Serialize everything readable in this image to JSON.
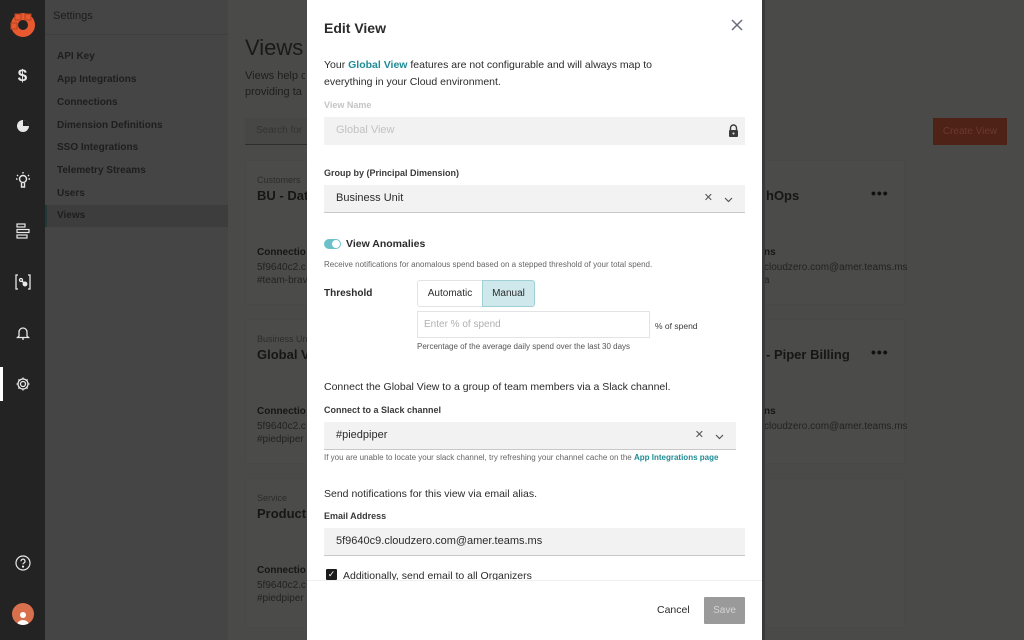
{
  "rail": {
    "icons": [
      "cloudzero-logo-icon",
      "dollar-icon",
      "pie-chart-icon",
      "lightbulb-icon",
      "list-icon",
      "bracket-node-icon",
      "bell-icon",
      "gear-icon",
      "help-icon",
      "user-avatar-icon"
    ],
    "active": "gear-icon",
    "brand_color": "#e8592f"
  },
  "settings": {
    "title": "Settings",
    "items": [
      {
        "label": "API Key"
      },
      {
        "label": "App Integrations"
      },
      {
        "label": "Connections"
      },
      {
        "label": "Dimension Definitions"
      },
      {
        "label": "SSO Integrations"
      },
      {
        "label": "Telemetry Streams"
      },
      {
        "label": "Users"
      },
      {
        "label": "Views",
        "active": true
      }
    ]
  },
  "page": {
    "title": "Views",
    "desc_line1": "Views help c",
    "desc_line2": "providing ta",
    "search_placeholder": "Search for",
    "create_button": "Create View",
    "cards": [
      {
        "type": "Customers",
        "name": "BU - Dat",
        "conn_label": "Connectio",
        "conn_email": "5f9640c2.c",
        "conn_slack": "#team-brav",
        "right_name": "hOps",
        "right_conn_label": "ns",
        "right_conn_email": "cloudzero.com@amer.teams.ms",
        "right_conn_slack": "a"
      },
      {
        "type": "Business Unit",
        "name": "Global V",
        "conn_label": "Connectio",
        "conn_email": "5f9640c2.c",
        "conn_slack": "#piedpiper",
        "right_name": "- Piper Billing",
        "right_conn_label": "ns",
        "right_conn_email": "cloudzero.com@amer.teams.ms",
        "right_conn_slack": ""
      },
      {
        "type": "Service",
        "name": "Product",
        "conn_label": "Connectio",
        "conn_email": "5f9640c2.c",
        "conn_slack": "#piedpiper",
        "right_name": "",
        "right_conn_label": "",
        "right_conn_email": "",
        "right_conn_slack": ""
      }
    ],
    "more_label": "•••"
  },
  "modal": {
    "title": "Edit View",
    "intro_prefix": "Your ",
    "intro_link": "Global View",
    "intro_suffix": " features are not configurable and will always map to everything in your Cloud environment.",
    "view_name_label": "View Name",
    "view_name_value": "Global View",
    "group_by_label": "Group by (Principal Dimension)",
    "group_by_value": "Business Unit",
    "anomalies_label": "View Anomalies",
    "anomalies_enabled": true,
    "anomalies_help": "Receive notifications for anomalous spend based on a stepped threshold of your total spend.",
    "threshold_label": "Threshold",
    "threshold_options": [
      "Automatic",
      "Manual"
    ],
    "threshold_selected": "Manual",
    "pct_placeholder": "Enter % of spend",
    "pct_suffix": "% of spend",
    "pct_help": "Percentage of the average daily spend over the last 30 days",
    "slack_intro": "Connect the Global View to a group of team members via a Slack channel.",
    "slack_label": "Connect to a Slack channel",
    "slack_value": "#piedpiper",
    "slack_help_prefix": "If you are unable to locate your slack channel, try refreshing your channel cache on the ",
    "slack_help_link": "App Integrations page",
    "email_intro": "Send notifications for this view via email alias.",
    "email_label": "Email Address",
    "email_value": "5f9640c9.cloudzero.com@amer.teams.ms",
    "organizers_label": "Additionally, send email to all Organizers",
    "organizers_checked": true,
    "cancel_label": "Cancel",
    "save_label": "Save",
    "accent_color": "#1f8c96"
  }
}
